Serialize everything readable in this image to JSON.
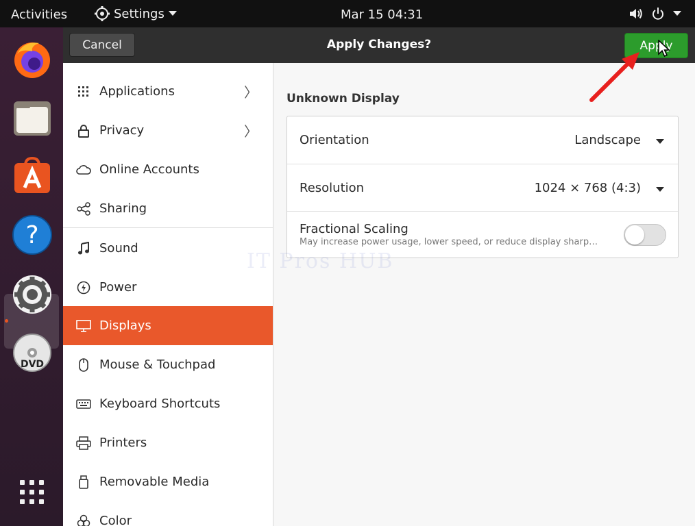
{
  "topbar": {
    "activities": "Activities",
    "app_menu": "Settings",
    "clock": "Mar 15  04:31"
  },
  "dock": {
    "apps": [
      "firefox-icon",
      "files-icon",
      "software-icon",
      "help-icon",
      "settings-icon",
      "dvd-icon",
      "show-apps-icon"
    ]
  },
  "headerbar": {
    "cancel_label": "Cancel",
    "title": "Apply Changes?",
    "apply_label": "Apply"
  },
  "sidebar": {
    "items": [
      {
        "label": "Applications",
        "icon": "grid-icon",
        "chevron": "〉"
      },
      {
        "label": "Privacy",
        "icon": "lock-icon",
        "chevron": "〉"
      },
      {
        "label": "Online Accounts",
        "icon": "cloud-icon"
      },
      {
        "label": "Sharing",
        "icon": "share-icon"
      },
      {
        "label": "Sound",
        "icon": "music-note-icon"
      },
      {
        "label": "Power",
        "icon": "power-icon"
      },
      {
        "label": "Displays",
        "icon": "display-icon",
        "selected": true
      },
      {
        "label": "Mouse & Touchpad",
        "icon": "mouse-icon"
      },
      {
        "label": "Keyboard Shortcuts",
        "icon": "keyboard-icon"
      },
      {
        "label": "Printers",
        "icon": "printer-icon"
      },
      {
        "label": "Removable Media",
        "icon": "removable-media-icon"
      },
      {
        "label": "Color",
        "icon": "color-icon"
      }
    ]
  },
  "display": {
    "section_title": "Unknown Display",
    "orientation": {
      "label": "Orientation",
      "value": "Landscape"
    },
    "resolution": {
      "label": "Resolution",
      "value": "1024 × 768 (4:3)"
    },
    "fractional_scaling": {
      "label": "Fractional Scaling",
      "description": "May increase power usage, lower speed, or reduce display sharp…",
      "enabled": false
    }
  },
  "watermark": "IT Pros HUB",
  "colors": {
    "accent": "#e9582b",
    "apply_green": "#2c9c2c",
    "annotation_arrow": "#e8201e"
  }
}
